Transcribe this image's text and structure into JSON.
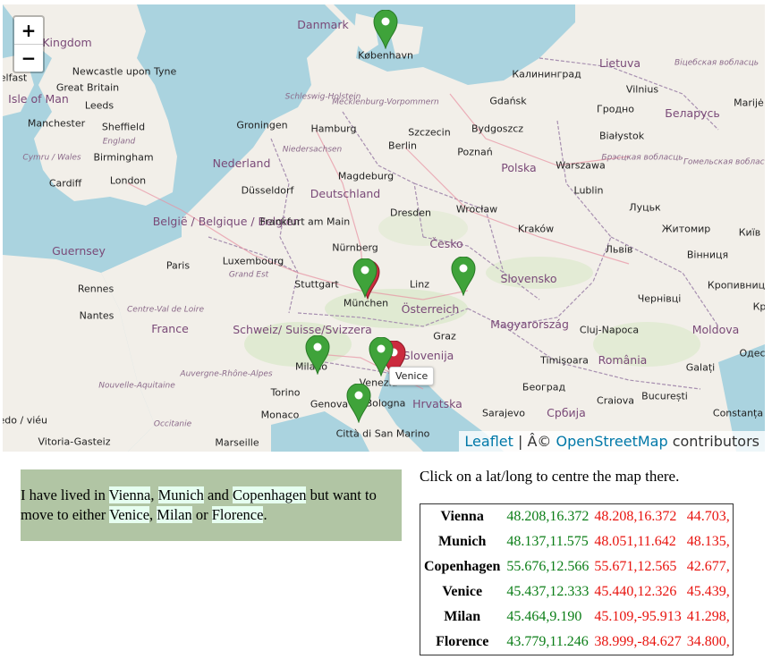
{
  "map": {
    "zoom_in": "+",
    "zoom_out": "−",
    "tooltip": "Venice",
    "attribution": {
      "leaflet": "Leaflet",
      "sep": " | Â© ",
      "osm": "OpenStreetMap",
      "rest": " contributors"
    },
    "labels": {
      "kingdom": "Kingdom",
      "great_britain": "Great Britain",
      "isle_of_man": "Isle of Man",
      "elfast": "elfast",
      "newcastle": "Newcastle upon Tyne",
      "leeds": "Leeds",
      "manchester": "Manchester",
      "sheffield": "Sheffield",
      "england": "England",
      "cymru": "Cymru / Wales",
      "birmingham": "Birmingham",
      "cardiff": "Cardiff",
      "london": "London",
      "guernsey": "Guernsey",
      "paris": "Paris",
      "rennes": "Rennes",
      "nantes": "Nantes",
      "france": "France",
      "centre": "Centre-Val de Loire",
      "nouvelle": "Nouvelle-Aquitaine",
      "occitanie": "Occitanie",
      "auvergne": "Auvergne-Rhône-Alpes",
      "vitoria": "Vitoria-Gasteiz",
      "marseille": "Marseille",
      "monaco": "Monaco",
      "torino": "Torino",
      "genova": "Genova",
      "viedo": "viedo / viéu",
      "danmark": "Danmark",
      "kobenhavn": "København",
      "schleswig": "Schleswig-Holstein",
      "mecklenburg": "Mecklenburg-Vorpommern",
      "groningen": "Groningen",
      "hamburg": "Hamburg",
      "niedersachsen": "Niedersachsen",
      "nederland": "Nederland",
      "berlin": "Berlin",
      "szczecin": "Szczecin",
      "magdeburg": "Magdeburg",
      "dusseldorf": "Düsseldorf",
      "deutschland": "Deutschland",
      "belgie": "België / Belgique / Belgien",
      "frankfurt": "Frankfurt am Main",
      "dresden": "Dresden",
      "luxembourg": "Luxembourg",
      "grand_est": "Grand Est",
      "nurnberg": "Nürnberg",
      "stuttgart": "Stuttgart",
      "munchen": "München",
      "linz": "Linz",
      "cesko": "Česko",
      "osterreich": "Österreich",
      "schweiz": "Schweiz/ Suisse/Svizzera",
      "milano": "Milano",
      "venezia": "Venezia",
      "bologna": "Bologna",
      "firenze": "Città di San Marino",
      "graz": "Graz",
      "slovenija": "Slovenija",
      "hrvatska": "Hrvatska",
      "sarajevo": "Sarajevo",
      "gdansk": "Gdańsk",
      "kaliningrad": "Калининград",
      "lietuva": "Lietuva",
      "vilnius": "Vilnius",
      "bydgoszcz": "Bydgoszcz",
      "poznan": "Poznań",
      "polska": "Polska",
      "warszawa": "Warszawa",
      "bialystok": "Białystok",
      "grodno": "Гродно",
      "belarus": "Беларусь",
      "wroclaw": "Wrocław",
      "lublin": "Lublin",
      "lutsk": "Луцьк",
      "krakow": "Kraków",
      "lviv": "Львів",
      "zhytomyr": "Житомир",
      "kyiv": "Київ",
      "slovensko": "Slovensko",
      "vinnytsia": "Вінниця",
      "chernivtsi": "Чернівці",
      "kropyvnytskyi": "Кропивниц",
      "magyarorszag": "Magyarország",
      "cluj": "Cluj-Napoca",
      "moldova": "Moldova",
      "timisoara": "Timișoara",
      "romania": "România",
      "galati": "Galați",
      "beograd": "Београд",
      "srbija": "Србија",
      "craiova": "Craiova",
      "bucuresti": "București",
      "constanta": "Constanța",
      "odesa": "Одес",
      "marijampole": "Marijė",
      "vitebsk": "Віцебская вобласць",
      "brest": "Брэсцкая вобласць",
      "gomel": "Гомельская вобласць",
      "kp": "Кр"
    }
  },
  "bio": {
    "intro": "I have lived in ",
    "vienna": "Vienna",
    "c1": ", ",
    "munich": "Munich",
    "and": " and ",
    "copenhagen": "Copenhagen",
    "but": " but want to move to either ",
    "venice": "Venice",
    "c2": ", ",
    "milan": "Milan",
    "or": " or ",
    "florence": "Florence",
    "end": "."
  },
  "instruction": "Click on a lat/long to centre the map there.",
  "table": [
    {
      "name": "Vienna",
      "a": "48.208,16.372",
      "b": "48.208,16.372",
      "c": "44.703,"
    },
    {
      "name": "Munich",
      "a": "48.137,11.575",
      "b": "48.051,11.642",
      "c": "48.135,"
    },
    {
      "name": "Copenhagen",
      "a": "55.676,12.566",
      "b": "55.671,12.565",
      "c": "42.677,"
    },
    {
      "name": "Venice",
      "a": "45.437,12.333",
      "b": "45.440,12.326",
      "c": "45.439,"
    },
    {
      "name": "Milan",
      "a": "45.464,9.190",
      "b": "45.109,-95.913",
      "c": "41.298,"
    },
    {
      "name": "Florence",
      "a": "43.779,11.246",
      "b": "38.999,-84.627",
      "c": "34.800,"
    }
  ],
  "colors": {
    "marker_green": "#3fa33a",
    "marker_red": "#cb2b3e",
    "coord_green": "#0a7d16",
    "coord_red": "#e8130e",
    "bio_bg": "#b1c5a4",
    "city_bg": "#e6fff0"
  }
}
